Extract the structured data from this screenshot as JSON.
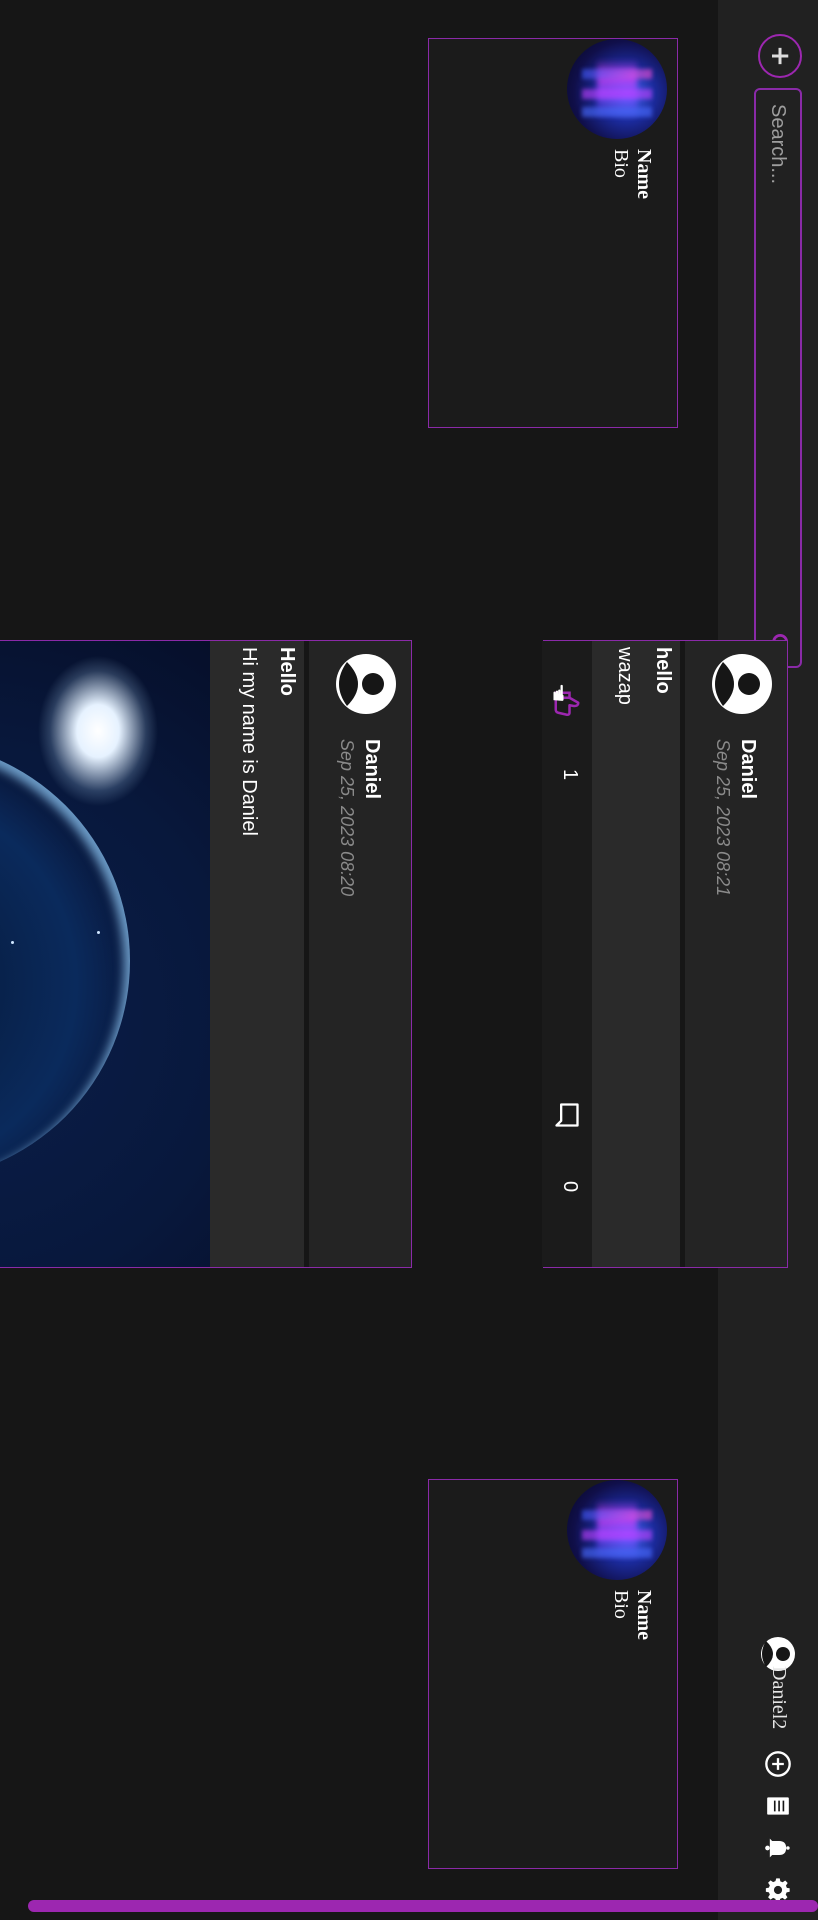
{
  "topbar": {
    "logo_glyph": "+",
    "search": {
      "placeholder": "Search...",
      "value": ""
    },
    "nav": {
      "home": "home-icon",
      "media": "media-icon"
    },
    "user": {
      "name": "Daniel2"
    },
    "icons": [
      "add-circle-icon",
      "document-icon",
      "bell-icon",
      "gear-icon"
    ],
    "accent": "#9c27b0"
  },
  "profile_cards": [
    {
      "name": "Name",
      "bio": "Bio"
    },
    {
      "name": "Name",
      "bio": "Bio"
    }
  ],
  "posts": [
    {
      "author": "Daniel",
      "date": "Sep 25, 2023 08:21",
      "title": "hello",
      "text": "wazap",
      "likes": "1",
      "comments": "0"
    },
    {
      "author": "Daniel",
      "date": "Sep 25, 2023 08:20",
      "title": "Hello",
      "text": "Hi my name is Daniel"
    }
  ]
}
